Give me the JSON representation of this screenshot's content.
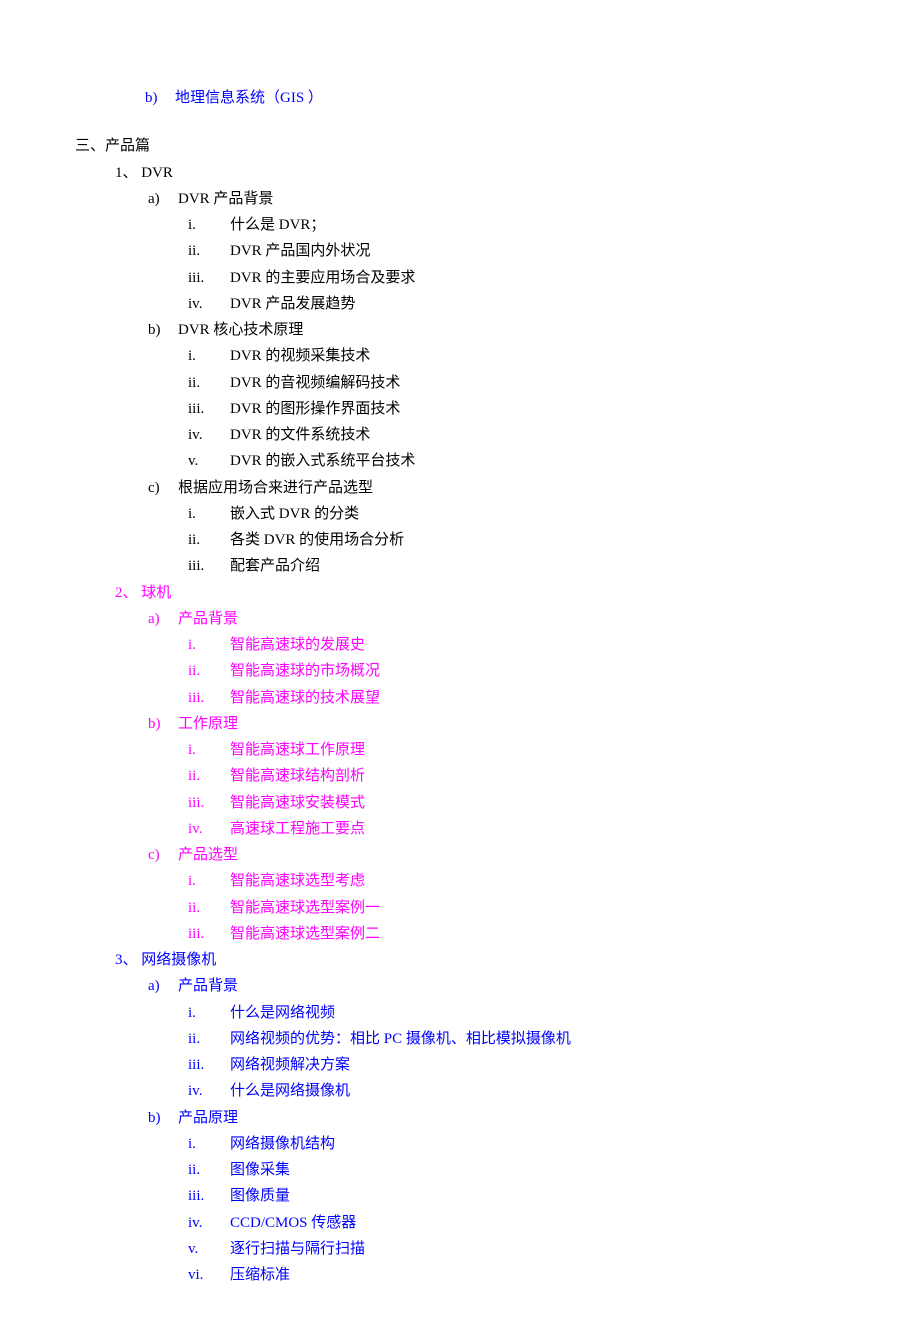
{
  "top": {
    "marker": "b)",
    "text": "地理信息系统（GIS ）"
  },
  "h1": "三、产品篇",
  "sections": [
    {
      "color": "black",
      "marker": "1、",
      "title": " DVR",
      "subs": [
        {
          "marker": "a)",
          "title": "DVR 产品背景",
          "items": [
            {
              "marker": "i.",
              "text": "什么是 DVR；"
            },
            {
              "marker": "ii.",
              "text": "DVR 产品国内外状况"
            },
            {
              "marker": "iii.",
              "text": "DVR 的主要应用场合及要求"
            },
            {
              "marker": "iv.",
              "text": "DVR 产品发展趋势"
            }
          ]
        },
        {
          "marker": "b)",
          "title": "DVR 核心技术原理",
          "items": [
            {
              "marker": "i.",
              "text": "DVR 的视频采集技术"
            },
            {
              "marker": "ii.",
              "text": "DVR 的音视频编解码技术"
            },
            {
              "marker": "iii.",
              "text": "DVR 的图形操作界面技术"
            },
            {
              "marker": "iv.",
              "text": "DVR 的文件系统技术"
            },
            {
              "marker": "v.",
              "text": "DVR 的嵌入式系统平台技术"
            }
          ]
        },
        {
          "marker": "c)",
          "title": "根据应用场合来进行产品选型",
          "items": [
            {
              "marker": "i.",
              "text": "嵌入式 DVR 的分类"
            },
            {
              "marker": "ii.",
              "text": "各类 DVR 的使用场合分析"
            },
            {
              "marker": "iii.",
              "text": "配套产品介绍"
            }
          ]
        }
      ]
    },
    {
      "color": "magenta",
      "marker": "2、",
      "title": " 球机",
      "subs": [
        {
          "marker": "a)",
          "title": "产品背景",
          "items": [
            {
              "marker": "i.",
              "text": "智能高速球的发展史"
            },
            {
              "marker": "ii.",
              "text": "智能高速球的市场概况"
            },
            {
              "marker": "iii.",
              "text": "智能高速球的技术展望"
            }
          ]
        },
        {
          "marker": "b)",
          "title": "工作原理",
          "items": [
            {
              "marker": "i.",
              "text": "智能高速球工作原理"
            },
            {
              "marker": "ii.",
              "text": "智能高速球结构剖析"
            },
            {
              "marker": "iii.",
              "text": "智能高速球安装模式"
            },
            {
              "marker": "iv.",
              "text": "高速球工程施工要点"
            }
          ]
        },
        {
          "marker": "c)",
          "title": "产品选型",
          "items": [
            {
              "marker": "i.",
              "text": "智能高速球选型考虑"
            },
            {
              "marker": "ii.",
              "text": "智能高速球选型案例一"
            },
            {
              "marker": "iii.",
              "text": "智能高速球选型案例二"
            }
          ]
        }
      ]
    },
    {
      "color": "blue",
      "marker": "3、",
      "title": " 网络摄像机",
      "subs": [
        {
          "marker": "a)",
          "title": "产品背景",
          "items": [
            {
              "marker": "i.",
              "text": "什么是网络视频"
            },
            {
              "marker": "ii.",
              "text": "网络视频的优势：相比 PC 摄像机、相比模拟摄像机"
            },
            {
              "marker": "iii.",
              "text": "网络视频解决方案"
            },
            {
              "marker": "iv.",
              "text": "什么是网络摄像机"
            }
          ]
        },
        {
          "marker": "b)",
          "title": "产品原理",
          "items": [
            {
              "marker": "i.",
              "text": "网络摄像机结构"
            },
            {
              "marker": "ii.",
              "text": "图像采集"
            },
            {
              "marker": "iii.",
              "text": "图像质量"
            },
            {
              "marker": "iv.",
              "text": "CCD/CMOS 传感器"
            },
            {
              "marker": "v.",
              "text": "逐行扫描与隔行扫描"
            },
            {
              "marker": "vi.",
              "text": "压缩标准"
            }
          ]
        }
      ]
    }
  ]
}
